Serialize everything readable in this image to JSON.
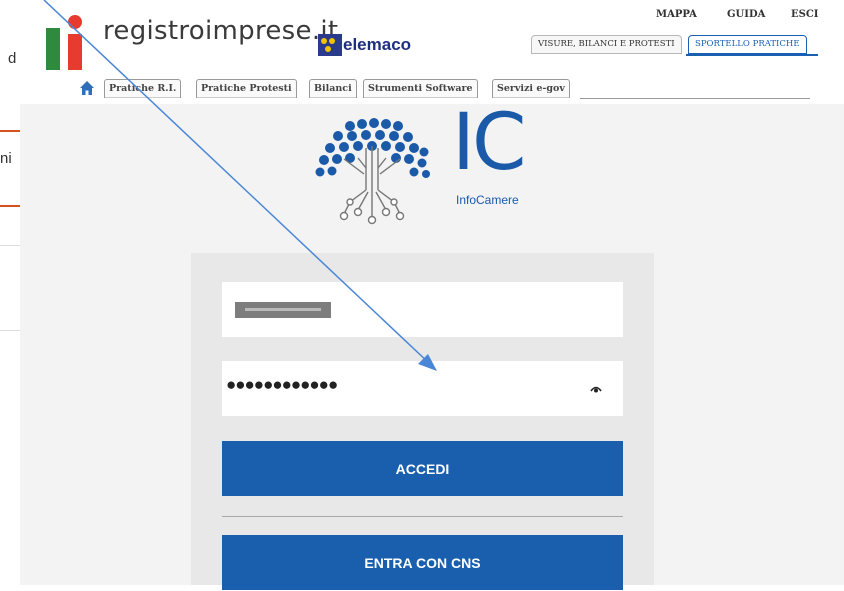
{
  "left_fragments": {
    "d": "d",
    "ni": "ni"
  },
  "header": {
    "brand": "registroimprese.it",
    "telemaco": "elemaco",
    "top_links": [
      "MAPPA",
      "GUIDA",
      "ESCI"
    ],
    "segments": [
      "VISURE, BILANCI E PROTESTI",
      "SPORTELLO PRATICHE"
    ],
    "nav_tabs": [
      "Pratiche R.I.",
      "Pratiche Protesti",
      "Bilanci",
      "Strumenti Software",
      "Servizi e-gov"
    ],
    "home_icon": "home-icon"
  },
  "infocamere": {
    "letters": "IC",
    "name": "InfoCamere",
    "logo_icon": "tree-logo"
  },
  "login": {
    "username": "",
    "password_mask": "●●●●●●●●●●●●",
    "accedi_label": "ACCEDI",
    "cns_label": "ENTRA CON CNS",
    "eye_icon": "eye-icon"
  },
  "colors": {
    "accent": "#1a5fae",
    "brand_red": "#e63b2e",
    "brand_green": "#2e8b3d",
    "arrow": "#4a86d8"
  }
}
